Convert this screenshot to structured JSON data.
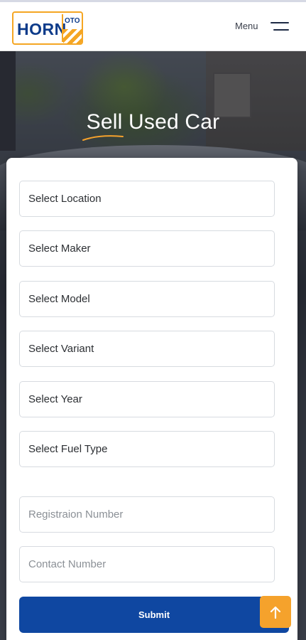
{
  "header": {
    "logo": {
      "text_main": "HORN",
      "text_sub": "OTO"
    },
    "menu_label": "Menu",
    "menu_icon": "hamburger-icon"
  },
  "hero": {
    "title": "Sell Used Car"
  },
  "form": {
    "selects": [
      {
        "label": "Select Location"
      },
      {
        "label": "Select Maker"
      },
      {
        "label": "Select Model"
      },
      {
        "label": "Select Variant"
      },
      {
        "label": "Select Year"
      },
      {
        "label": "Select Fuel Type"
      }
    ],
    "inputs": [
      {
        "placeholder": "Registraion Number"
      },
      {
        "placeholder": "Contact Number"
      }
    ],
    "submit_label": "Submit"
  },
  "scroll_top": {
    "icon": "arrow-up-icon"
  },
  "colors": {
    "brand_blue": "#0f47a1",
    "brand_orange": "#f5a22c"
  }
}
